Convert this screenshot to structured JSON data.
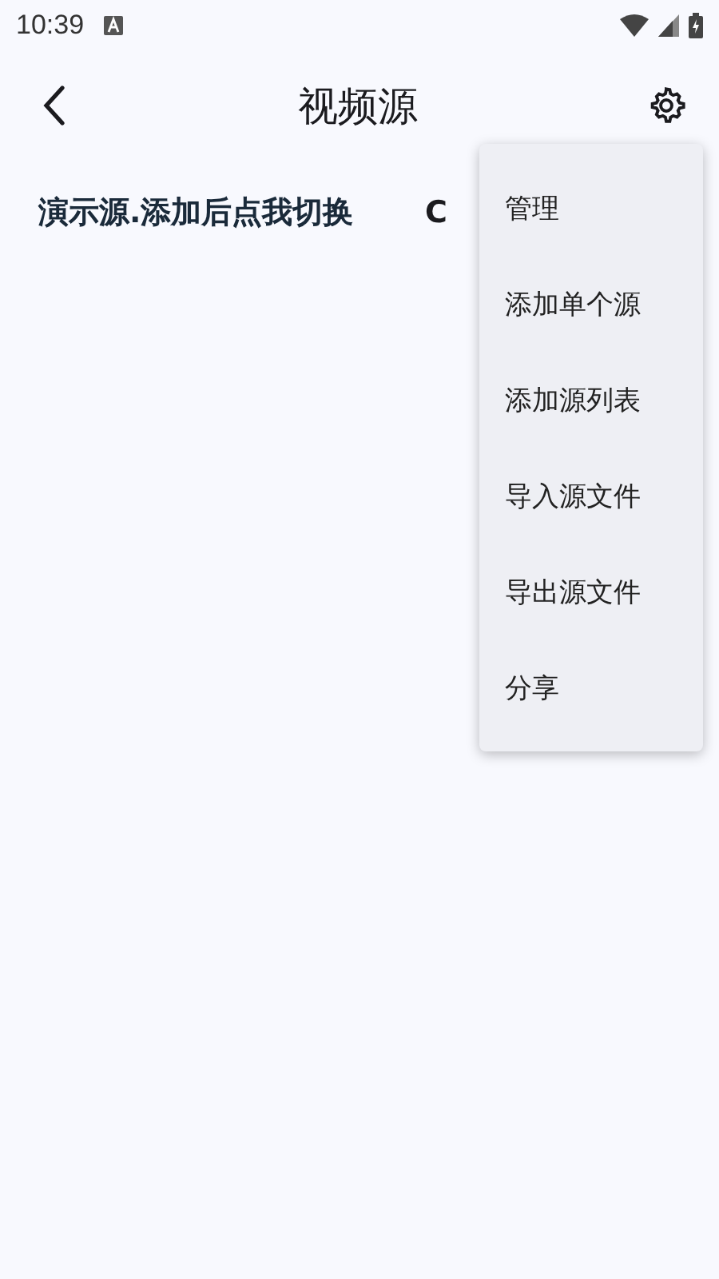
{
  "status_bar": {
    "time": "10:39"
  },
  "app_bar": {
    "title": "视频源"
  },
  "source_row": {
    "name": "演示源.添加后点我切换",
    "trailing": "C"
  },
  "menu": {
    "items": [
      {
        "label": "管理"
      },
      {
        "label": "添加单个源"
      },
      {
        "label": "添加源列表"
      },
      {
        "label": "导入源文件"
      },
      {
        "label": "导出源文件"
      },
      {
        "label": "分享"
      }
    ]
  }
}
